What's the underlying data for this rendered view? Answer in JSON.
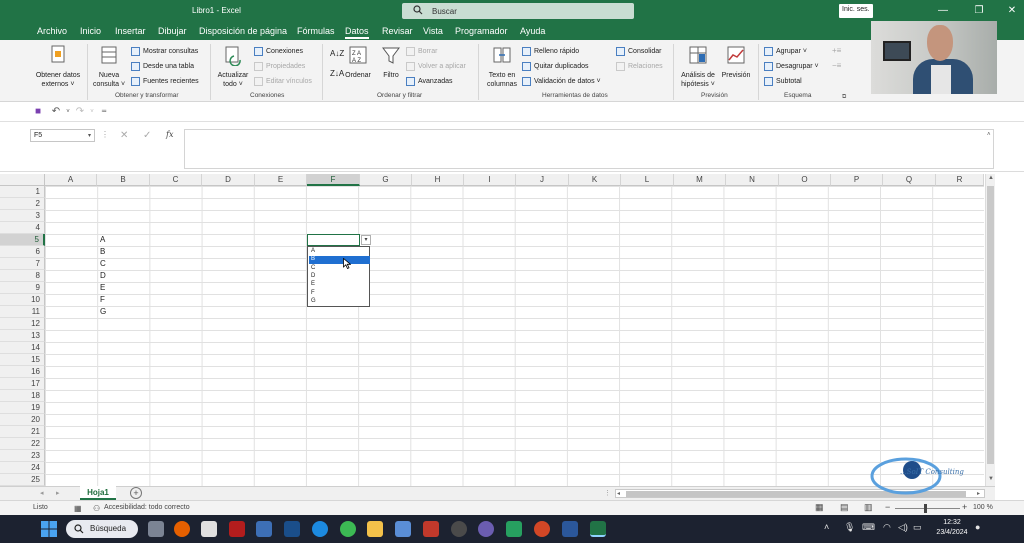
{
  "titlebar": {
    "doc_title": "Libro1  -  Excel",
    "search_placeholder": "Buscar",
    "signin": "Inic. ses."
  },
  "menu_tabs": [
    "Archivo",
    "Inicio",
    "Insertar",
    "Dibujar",
    "Disposición de página",
    "Fórmulas",
    "Datos",
    "Revisar",
    "Vista",
    "Programador",
    "Ayuda"
  ],
  "active_tab": "Datos",
  "ribbon": {
    "groups": {
      "obtener": "Obtener y transformar",
      "conexiones": "Conexiones",
      "ordenar": "Ordenar y filtrar",
      "herramientas": "Herramientas de datos",
      "prevision": "Previsión",
      "esquema": "Esquema"
    },
    "obtener_datos": [
      "Obtener datos",
      "externos ˅"
    ],
    "nueva_consulta": [
      "Nueva",
      "consulta ˅"
    ],
    "mostrar_consultas": "Mostrar consultas",
    "desde_tabla": "Desde una tabla",
    "fuentes_recientes": "Fuentes recientes",
    "actualizar": [
      "Actualizar",
      "todo ˅"
    ],
    "conexiones": "Conexiones",
    "propiedades": "Propiedades",
    "editar_vinculos": "Editar vínculos",
    "ordenar": "Ordenar",
    "filtro": "Filtro",
    "borrar": "Borrar",
    "volver_aplicar": "Volver a aplicar",
    "avanzadas": "Avanzadas",
    "texto_columnas": [
      "Texto en",
      "columnas"
    ],
    "relleno_rapido": "Relleno rápido",
    "quitar_duplicados": "Quitar duplicados",
    "validacion": "Validación de datos  ˅",
    "consolidar": "Consolidar",
    "relaciones": "Relaciones",
    "analisis": [
      "Análisis de",
      "hipótesis ˅"
    ],
    "prevision": "Previsión",
    "agrupar": "Agrupar  ˅",
    "desagrupar": "Desagrupar  ˅",
    "subtotal": "Subtotal"
  },
  "formula_bar": {
    "name_box": "F5",
    "formula": ""
  },
  "columns": [
    "A",
    "B",
    "C",
    "D",
    "E",
    "F",
    "G",
    "H",
    "I",
    "J",
    "K",
    "L",
    "M",
    "N",
    "O",
    "P",
    "Q",
    "R"
  ],
  "selected_column": "F",
  "rows": [
    "1",
    "2",
    "3",
    "4",
    "5",
    "6",
    "7",
    "8",
    "9",
    "10",
    "11",
    "12",
    "13",
    "14",
    "15",
    "16",
    "17",
    "18",
    "19",
    "20",
    "21",
    "22",
    "23",
    "24",
    "25"
  ],
  "selected_row": "5",
  "cells_b": [
    {
      "row": "5",
      "value": "A"
    },
    {
      "row": "6",
      "value": "B"
    },
    {
      "row": "7",
      "value": "C"
    },
    {
      "row": "8",
      "value": "D"
    },
    {
      "row": "9",
      "value": "E"
    },
    {
      "row": "10",
      "value": "F"
    },
    {
      "row": "11",
      "value": "G"
    }
  ],
  "dropdown_options": [
    "A",
    "B",
    "C",
    "D",
    "E",
    "F",
    "G"
  ],
  "dropdown_highlighted": "B",
  "sheet_tab": "Hoja1",
  "status": {
    "ready": "Listo",
    "accessibility": "Accesibilidad: todo correcto",
    "zoom": "100 %"
  },
  "taskbar": {
    "search": "Búsqueda",
    "time": "12:32",
    "date": "23/4/2024"
  },
  "watermark": "...SoIT Consulting",
  "colors": {
    "excel_green": "#217346",
    "highlight_blue": "#1f6fd1"
  }
}
